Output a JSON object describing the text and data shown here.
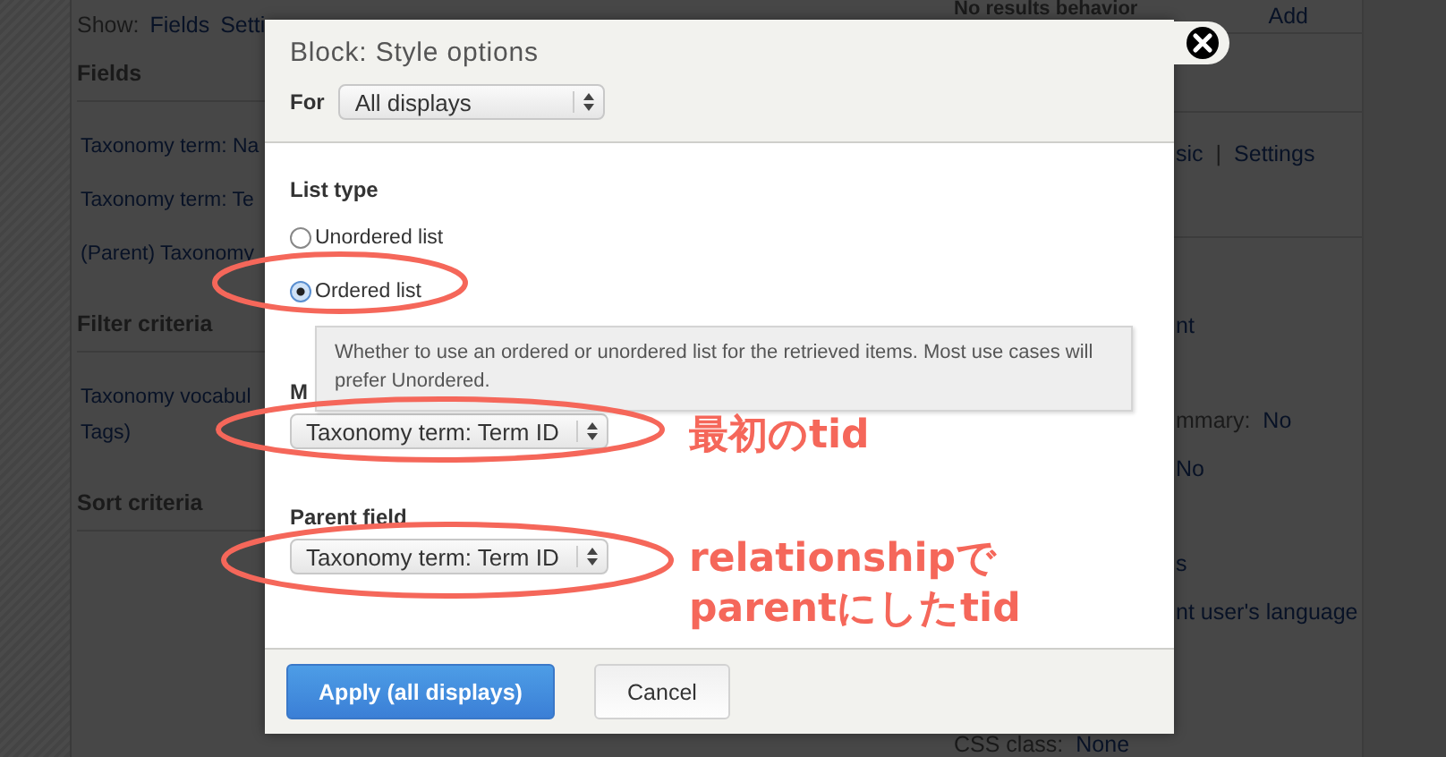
{
  "page": {
    "show_label": "Show:",
    "show_links": [
      "Fields",
      "Setti"
    ],
    "sections": [
      {
        "heading": "Fields",
        "items": [
          "Taxonomy term: Na",
          "Taxonomy term: Te",
          "(Parent) Taxonomy"
        ]
      },
      {
        "heading": "Filter criteria",
        "items": [
          "Taxonomy vocabul\nTags)"
        ]
      },
      {
        "heading": "Sort criteria"
      }
    ],
    "side": {
      "title": "No results behavior",
      "action": "Add",
      "rows": [
        {
          "kind": "fragment",
          "parts": [
            {
              "kind": "link",
              "text": "sic"
            },
            {
              "kind": "separator",
              "text": "|"
            },
            {
              "kind": "link",
              "text": "Settings"
            }
          ]
        },
        {
          "kind": "fragment",
          "parts": [
            {
              "kind": "link",
              "text": "nt"
            }
          ]
        },
        {
          "kind": "fragment",
          "parts": [
            {
              "kind": "label",
              "text": "mmary:"
            },
            {
              "kind": "link",
              "text": "No"
            }
          ]
        },
        {
          "kind": "fragment",
          "parts": [
            {
              "kind": "link",
              "text": "No"
            }
          ]
        },
        {
          "kind": "fragment",
          "parts": [
            {
              "kind": "link",
              "text": "s"
            }
          ]
        },
        {
          "kind": "fragment",
          "parts": [
            {
              "kind": "link",
              "text": "nt user's language"
            }
          ]
        },
        {
          "kind": "full",
          "parts": [
            {
              "kind": "label",
              "text": "CSS class:"
            },
            {
              "kind": "link",
              "text": "None"
            }
          ]
        }
      ]
    }
  },
  "dialog": {
    "title": "Block: Style options",
    "for_label": "For",
    "for_value": "All displays",
    "list_type": "List type",
    "radios": [
      {
        "label": "Unordered list",
        "selected": false
      },
      {
        "label": "Ordered list",
        "selected": true
      }
    ],
    "tooltip": "Whether to use an ordered or unordered list for the retrieved items. Most use cases will prefer Unordered.",
    "fields": [
      {
        "label": "M",
        "value": "Taxonomy term: Term ID"
      },
      {
        "label": "Parent field",
        "value": "Taxonomy term: Term ID"
      }
    ],
    "buttons": [
      {
        "label": "Apply (all displays)",
        "kind": "primary"
      },
      {
        "label": "Cancel",
        "kind": "secondary"
      }
    ]
  },
  "annotations": [
    {
      "lines": [
        "最初のtid"
      ]
    },
    {
      "lines": [
        "relationshipで",
        "parentにしたtid"
      ]
    }
  ]
}
